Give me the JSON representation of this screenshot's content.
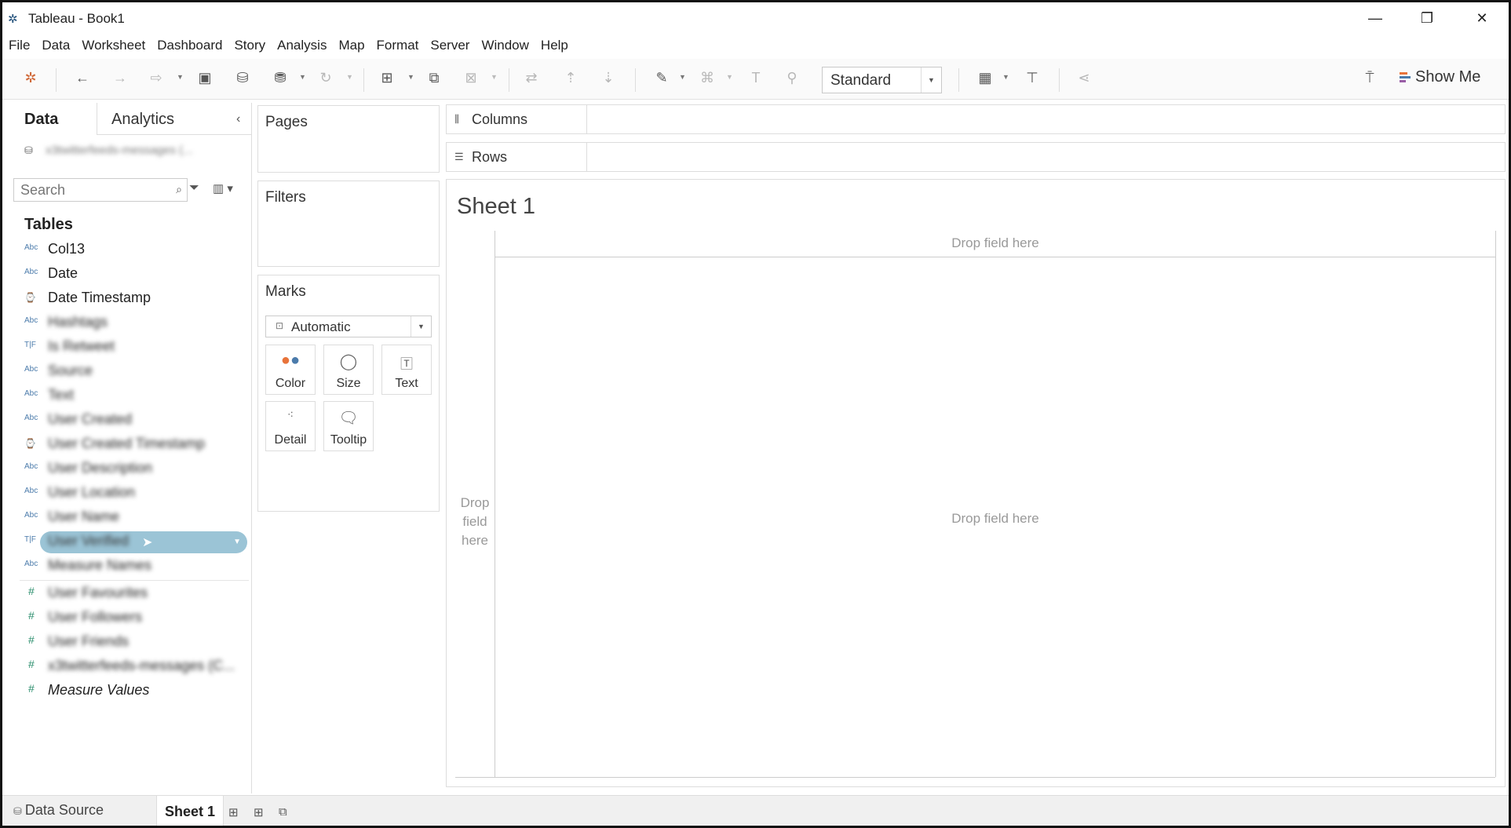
{
  "window": {
    "title": "Tableau - Book1",
    "minimize": "—",
    "restore": "❐",
    "close": "✕"
  },
  "menu": [
    "File",
    "Data",
    "Worksheet",
    "Dashboard",
    "Story",
    "Analysis",
    "Map",
    "Format",
    "Server",
    "Window",
    "Help"
  ],
  "toolbar": {
    "fit_select": "Standard",
    "show_me": "Show Me",
    "show_me_colors": [
      "#e8733a",
      "#4b7bab",
      "#9a5ea6"
    ]
  },
  "data_pane": {
    "tab_data": "Data",
    "tab_analytics": "Analytics",
    "datasource_name": "x3twitterfeeds-messages (...",
    "search_placeholder": "Search",
    "tables_header": "Tables",
    "dimensions": [
      {
        "type": "Abc",
        "label": "Col13",
        "blurred": false
      },
      {
        "type": "Abc",
        "label": "Date",
        "blurred": false
      },
      {
        "type": "date",
        "label": "Date Timestamp",
        "blurred": false
      },
      {
        "type": "Abc",
        "label": "Hashtags",
        "blurred": true
      },
      {
        "type": "T|F",
        "label": "Is Retweet",
        "blurred": true
      },
      {
        "type": "Abc",
        "label": "Source",
        "blurred": true
      },
      {
        "type": "Abc",
        "label": "Text",
        "blurred": true
      },
      {
        "type": "Abc",
        "label": "User Created",
        "blurred": true
      },
      {
        "type": "date",
        "label": "User Created Timestamp",
        "blurred": true
      },
      {
        "type": "Abc",
        "label": "User Description",
        "blurred": true
      },
      {
        "type": "Abc",
        "label": "User Location",
        "blurred": true
      },
      {
        "type": "Abc",
        "label": "User Name",
        "blurred": true
      },
      {
        "type": "T|F",
        "label": "User Verified",
        "blurred": true,
        "selected": true
      },
      {
        "type": "Abc",
        "label": "Measure Names",
        "blurred": true
      }
    ],
    "measures": [
      {
        "type": "#",
        "label": "User Favourites",
        "blurred": true
      },
      {
        "type": "#",
        "label": "User Followers",
        "blurred": true
      },
      {
        "type": "#",
        "label": "User Friends",
        "blurred": true
      },
      {
        "type": "#",
        "label": "x3twitterfeeds-messages (C...",
        "blurred": true
      },
      {
        "type": "#",
        "label": "Measure Values",
        "blurred": false,
        "italic": true
      }
    ]
  },
  "cards": {
    "pages": "Pages",
    "filters": "Filters",
    "marks": "Marks",
    "marks_type": "Automatic",
    "mark_buttons": {
      "color": "Color",
      "size": "Size",
      "text": "Text",
      "detail": "Detail",
      "tooltip": "Tooltip"
    }
  },
  "shelves": {
    "columns": "Columns",
    "rows": "Rows"
  },
  "sheet": {
    "title": "Sheet 1",
    "drop_top": "Drop field here",
    "drop_left": "Drop field here",
    "drop_body": "Drop field here"
  },
  "tabs": {
    "data_source": "Data Source",
    "sheet1": "Sheet 1"
  }
}
